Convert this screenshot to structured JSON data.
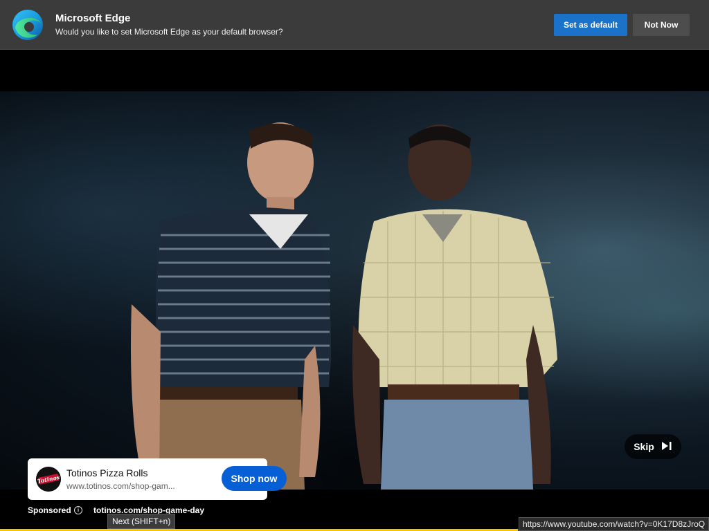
{
  "notification": {
    "app_name": "Microsoft Edge",
    "message": "Would you like to set Microsoft Edge as your default browser?",
    "set_default_label": "Set as default",
    "not_now_label": "Not Now",
    "logo_icon": "edge-logo-icon"
  },
  "player": {
    "skip_label": "Skip",
    "skip_icon": "skip-next-icon",
    "progress": 0.73,
    "progress_color": "#f6c600"
  },
  "ad": {
    "title": "Totinos Pizza Rolls",
    "url": "www.totinos.com/shop-gam...",
    "cta_label": "Shop now",
    "sponsored_label": "Sponsored",
    "sponsor_url": "totinos.com/shop-game-day",
    "info_icon": "info-icon",
    "logo_text": "Totinos"
  },
  "tooltip": {
    "text": "Next (SHIFT+n)"
  },
  "status_bar": {
    "url": "https://www.youtube.com/watch?v=0K17D8zJroQ"
  },
  "colors": {
    "edge_bar": "#3b3b3b",
    "primary_button": "#1a73c9",
    "shop_button": "#065fd4"
  }
}
